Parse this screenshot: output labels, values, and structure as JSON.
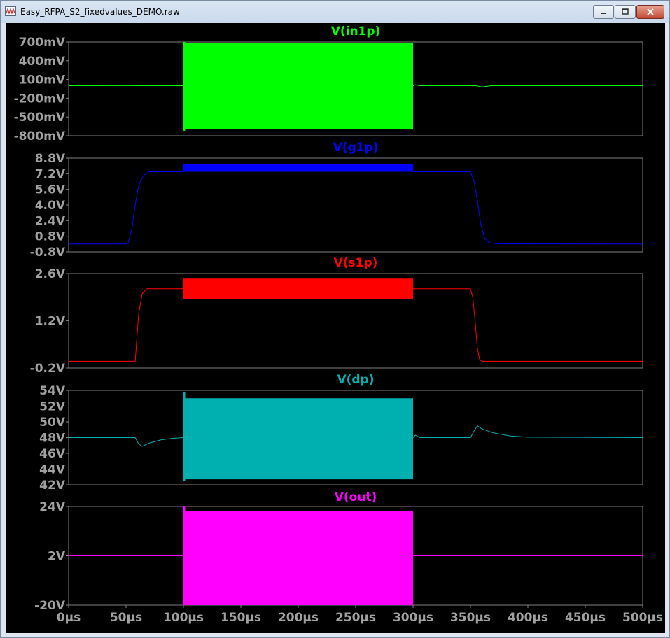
{
  "window": {
    "title": "Easy_RFPA_S2_fixedvalues_DEMO.raw",
    "icon": "waveform-icon",
    "buttons": {
      "minimize": "minimize-icon",
      "maximize": "maximize-icon",
      "close": "close-icon"
    }
  },
  "chart_data": {
    "type": "line",
    "x_label_unit": "µs",
    "x_ticks": [
      "0µs",
      "50µs",
      "100µs",
      "150µs",
      "200µs",
      "250µs",
      "300µs",
      "350µs",
      "400µs",
      "450µs",
      "500µs"
    ],
    "xlim": [
      0,
      500
    ],
    "grid": false,
    "panes": [
      {
        "title": "V(in1p)",
        "color": "#00ff00",
        "ylim": [
          -800,
          700
        ],
        "y_ticks": [
          "700mV",
          "400mV",
          "100mV",
          "-200mV",
          "-500mV",
          "-800mV"
        ],
        "baseline": [
          [
            0,
            0
          ],
          [
            50,
            2
          ],
          [
            60,
            0
          ],
          [
            100,
            0
          ]
        ],
        "burst": {
          "x_start": 100,
          "x_end": 300,
          "top": 680,
          "bottom": -700,
          "peak_top": 700,
          "peak_bottom": -720
        },
        "tail": [
          [
            300,
            0
          ],
          [
            302,
            15
          ],
          [
            306,
            0
          ],
          [
            355,
            0
          ],
          [
            360,
            -20
          ],
          [
            368,
            0
          ],
          [
            500,
            0
          ]
        ]
      },
      {
        "title": "V(g1p)",
        "color": "#0000ff",
        "ylim": [
          -800,
          8800
        ],
        "y_ticks": [
          "8.8V",
          "7.2V",
          "5.6V",
          "4.0V",
          "2.4V",
          "0.8V",
          "-0.8V"
        ],
        "baseline": [
          [
            0,
            0
          ],
          [
            50,
            0
          ],
          [
            52,
            150
          ],
          [
            55,
            1500
          ],
          [
            58,
            4000
          ],
          [
            61,
            6000
          ],
          [
            65,
            7000
          ],
          [
            70,
            7400
          ],
          [
            100,
            7400
          ]
        ],
        "burst": {
          "x_start": 100,
          "x_end": 300,
          "top": 8200,
          "bottom": 7400
        },
        "tail": [
          [
            300,
            7400
          ],
          [
            350,
            7400
          ],
          [
            353,
            6500
          ],
          [
            356,
            4500
          ],
          [
            359,
            2000
          ],
          [
            362,
            700
          ],
          [
            366,
            150
          ],
          [
            375,
            20
          ],
          [
            500,
            0
          ]
        ]
      },
      {
        "title": "V(s1p)",
        "color": "#ff0000",
        "ylim": [
          -200,
          2600
        ],
        "y_ticks": [
          "2.6V",
          "1.2V",
          "-0.2V"
        ],
        "baseline": [
          [
            0,
            0
          ],
          [
            58,
            0
          ],
          [
            59,
            500
          ],
          [
            61,
            1400
          ],
          [
            64,
            2000
          ],
          [
            68,
            2150
          ],
          [
            100,
            2150
          ]
        ],
        "burst": {
          "x_start": 100,
          "x_end": 300,
          "top": 2450,
          "bottom": 1850
        },
        "tail": [
          [
            300,
            2150
          ],
          [
            350,
            2150
          ],
          [
            352,
            1900
          ],
          [
            354,
            1200
          ],
          [
            356,
            400
          ],
          [
            358,
            50
          ],
          [
            360,
            0
          ],
          [
            500,
            0
          ]
        ]
      },
      {
        "title": "V(dp)",
        "color": "#00b0b0",
        "ylim": [
          42,
          54
        ],
        "y_ticks": [
          "54V",
          "52V",
          "50V",
          "48V",
          "46V",
          "44V",
          "42V"
        ],
        "baseline": [
          [
            0,
            48
          ],
          [
            58,
            48
          ],
          [
            61,
            47.2
          ],
          [
            64,
            46.9
          ],
          [
            70,
            47.3
          ],
          [
            80,
            47.7
          ],
          [
            90,
            47.9
          ],
          [
            100,
            48
          ]
        ],
        "burst": {
          "x_start": 100,
          "x_end": 300,
          "top": 53,
          "bottom": 42.7,
          "peak_top": 53.8,
          "peak_bottom": 42.5
        },
        "tail": [
          [
            300,
            48
          ],
          [
            302,
            48.3
          ],
          [
            306,
            48
          ],
          [
            350,
            48
          ],
          [
            353,
            48.8
          ],
          [
            356,
            49.5
          ],
          [
            360,
            49.1
          ],
          [
            370,
            48.6
          ],
          [
            385,
            48.2
          ],
          [
            400,
            48.05
          ],
          [
            500,
            48
          ]
        ]
      },
      {
        "title": "V(out)",
        "color": "#ff00ff",
        "ylim": [
          -20,
          24
        ],
        "y_ticks": [
          "24V",
          "2V",
          "-20V"
        ],
        "baseline": [
          [
            0,
            2
          ],
          [
            100,
            2
          ]
        ],
        "burst": {
          "x_start": 100,
          "x_end": 300,
          "top": 22,
          "bottom": -20,
          "peak_top": 24,
          "peak_bottom": -20
        },
        "tail": [
          [
            300,
            2
          ],
          [
            500,
            2
          ]
        ]
      }
    ]
  }
}
